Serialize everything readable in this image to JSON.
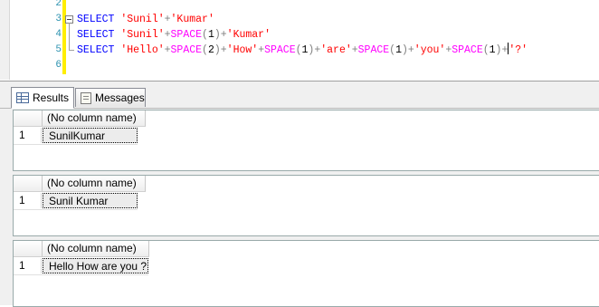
{
  "editor": {
    "lines": [
      {
        "num": "2",
        "tokens": []
      },
      {
        "num": "3",
        "tokens": [
          {
            "t": "kw",
            "v": "SELECT "
          },
          {
            "t": "str",
            "v": "'Sunil'"
          },
          {
            "t": "op",
            "v": "+"
          },
          {
            "t": "str",
            "v": "'Kumar'"
          }
        ]
      },
      {
        "num": "4",
        "tokens": [
          {
            "t": "kw",
            "v": "SELECT "
          },
          {
            "t": "str",
            "v": "'Sunil'"
          },
          {
            "t": "op",
            "v": "+"
          },
          {
            "t": "fn",
            "v": "SPACE"
          },
          {
            "t": "op",
            "v": "("
          },
          {
            "t": "plain",
            "v": "1"
          },
          {
            "t": "op",
            "v": ")+"
          },
          {
            "t": "str",
            "v": "'Kumar'"
          }
        ]
      },
      {
        "num": "5",
        "tokens": [
          {
            "t": "kw",
            "v": "SELECT "
          },
          {
            "t": "str",
            "v": "'Hello'"
          },
          {
            "t": "op",
            "v": "+"
          },
          {
            "t": "fn",
            "v": "SPACE"
          },
          {
            "t": "op",
            "v": "("
          },
          {
            "t": "plain",
            "v": "2"
          },
          {
            "t": "op",
            "v": ")+"
          },
          {
            "t": "str",
            "v": "'How'"
          },
          {
            "t": "op",
            "v": "+"
          },
          {
            "t": "fn",
            "v": "SPACE"
          },
          {
            "t": "op",
            "v": "("
          },
          {
            "t": "plain",
            "v": "1"
          },
          {
            "t": "op",
            "v": ")+"
          },
          {
            "t": "str",
            "v": "'are'"
          },
          {
            "t": "op",
            "v": "+"
          },
          {
            "t": "fn",
            "v": "SPACE"
          },
          {
            "t": "op",
            "v": "("
          },
          {
            "t": "plain",
            "v": "1"
          },
          {
            "t": "op",
            "v": ")+"
          },
          {
            "t": "str",
            "v": "'you'"
          },
          {
            "t": "op",
            "v": "+"
          },
          {
            "t": "fn",
            "v": "SPACE"
          },
          {
            "t": "op",
            "v": "("
          },
          {
            "t": "plain",
            "v": "1"
          },
          {
            "t": "op",
            "v": ")+"
          },
          {
            "t": "caret",
            "v": ""
          },
          {
            "t": "str",
            "v": "'?'"
          }
        ]
      },
      {
        "num": "6",
        "tokens": []
      }
    ],
    "colors": {
      "keyword": "#0000ff",
      "string": "#ff0000",
      "function": "#ff00ff",
      "operator": "#808080",
      "line_number": "#2b91af",
      "change_bar": "#ffee00"
    }
  },
  "tabs": {
    "results_label": "Results",
    "results_icon": "grid-icon",
    "messages_label": "Messages",
    "messages_icon": "messages-icon"
  },
  "results": [
    {
      "column_header": "(No column name)",
      "row_number": "1",
      "value": "SunilKumar"
    },
    {
      "column_header": "(No column name)",
      "row_number": "1",
      "value": "Sunil Kumar"
    },
    {
      "column_header": "(No column name)",
      "row_number": "1",
      "value": "Hello  How are you ?"
    }
  ]
}
